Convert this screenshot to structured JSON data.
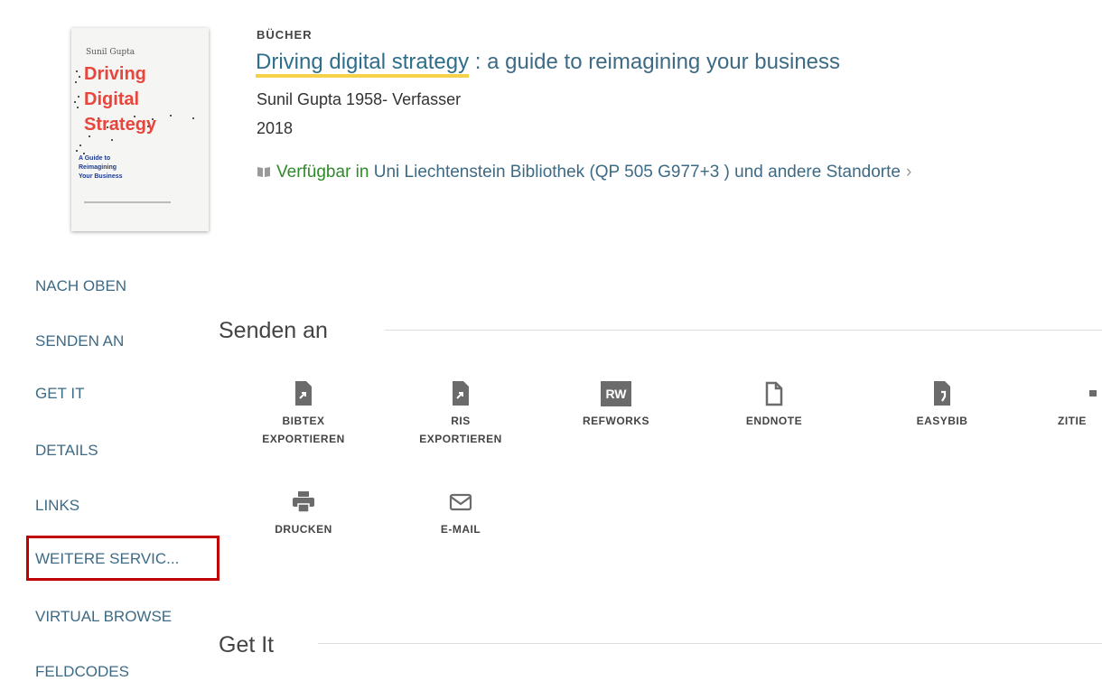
{
  "record": {
    "type": "BÜCHER",
    "title_main": "Driving digital strategy",
    "title_rest": " : a guide to reimagining your business",
    "author": "Sunil Gupta 1958- Verfasser",
    "year": "2018",
    "availability_status": "Verfügbar in",
    "availability_location": "Uni Liechtenstein  Bibliothek (QP 505 G977+3 ) und andere Standorte",
    "availability_chevron": "›"
  },
  "cover": {
    "author": "Sunil Gupta",
    "line1": "Driving",
    "line2": "Digital",
    "line3": "Strategy",
    "sub1": "A Guide to",
    "sub2": "Reimagining",
    "sub3": "Your Business"
  },
  "nav": {
    "items": [
      {
        "label": "NACH OBEN"
      },
      {
        "label": "SENDEN AN"
      },
      {
        "label": "GET IT"
      },
      {
        "label": "DETAILS"
      },
      {
        "label": "LINKS"
      },
      {
        "label": "WEITERE SERVIC..."
      },
      {
        "label": "VIRTUAL BROWSE"
      },
      {
        "label": "FELDCODES"
      }
    ]
  },
  "sections": {
    "send_to": "Senden an",
    "get_it": "Get It"
  },
  "actions": [
    {
      "line1": "BIBTEX",
      "line2": "EXPORTIEREN",
      "icon": "file-export-icon"
    },
    {
      "line1": "RIS",
      "line2": "EXPORTIEREN",
      "icon": "file-export-icon"
    },
    {
      "line1": "REFWORKS",
      "line2": "",
      "icon": "refworks-icon",
      "badge": "RW"
    },
    {
      "line1": "ENDNOTE",
      "line2": "",
      "icon": "endnote-icon"
    },
    {
      "line1": "EASYBIB",
      "line2": "",
      "icon": "easybib-icon"
    },
    {
      "line1": "ZITIE",
      "line2": "",
      "icon": "quote-icon"
    },
    {
      "line1": "DRUCKEN",
      "line2": "",
      "icon": "printer-icon"
    },
    {
      "line1": "E-MAIL",
      "line2": "",
      "icon": "email-icon"
    }
  ],
  "colors": {
    "link": "#3d6a85",
    "available": "#2f8a2a",
    "highlight_box": "#c00000",
    "title_underline": "#f6d24a"
  }
}
